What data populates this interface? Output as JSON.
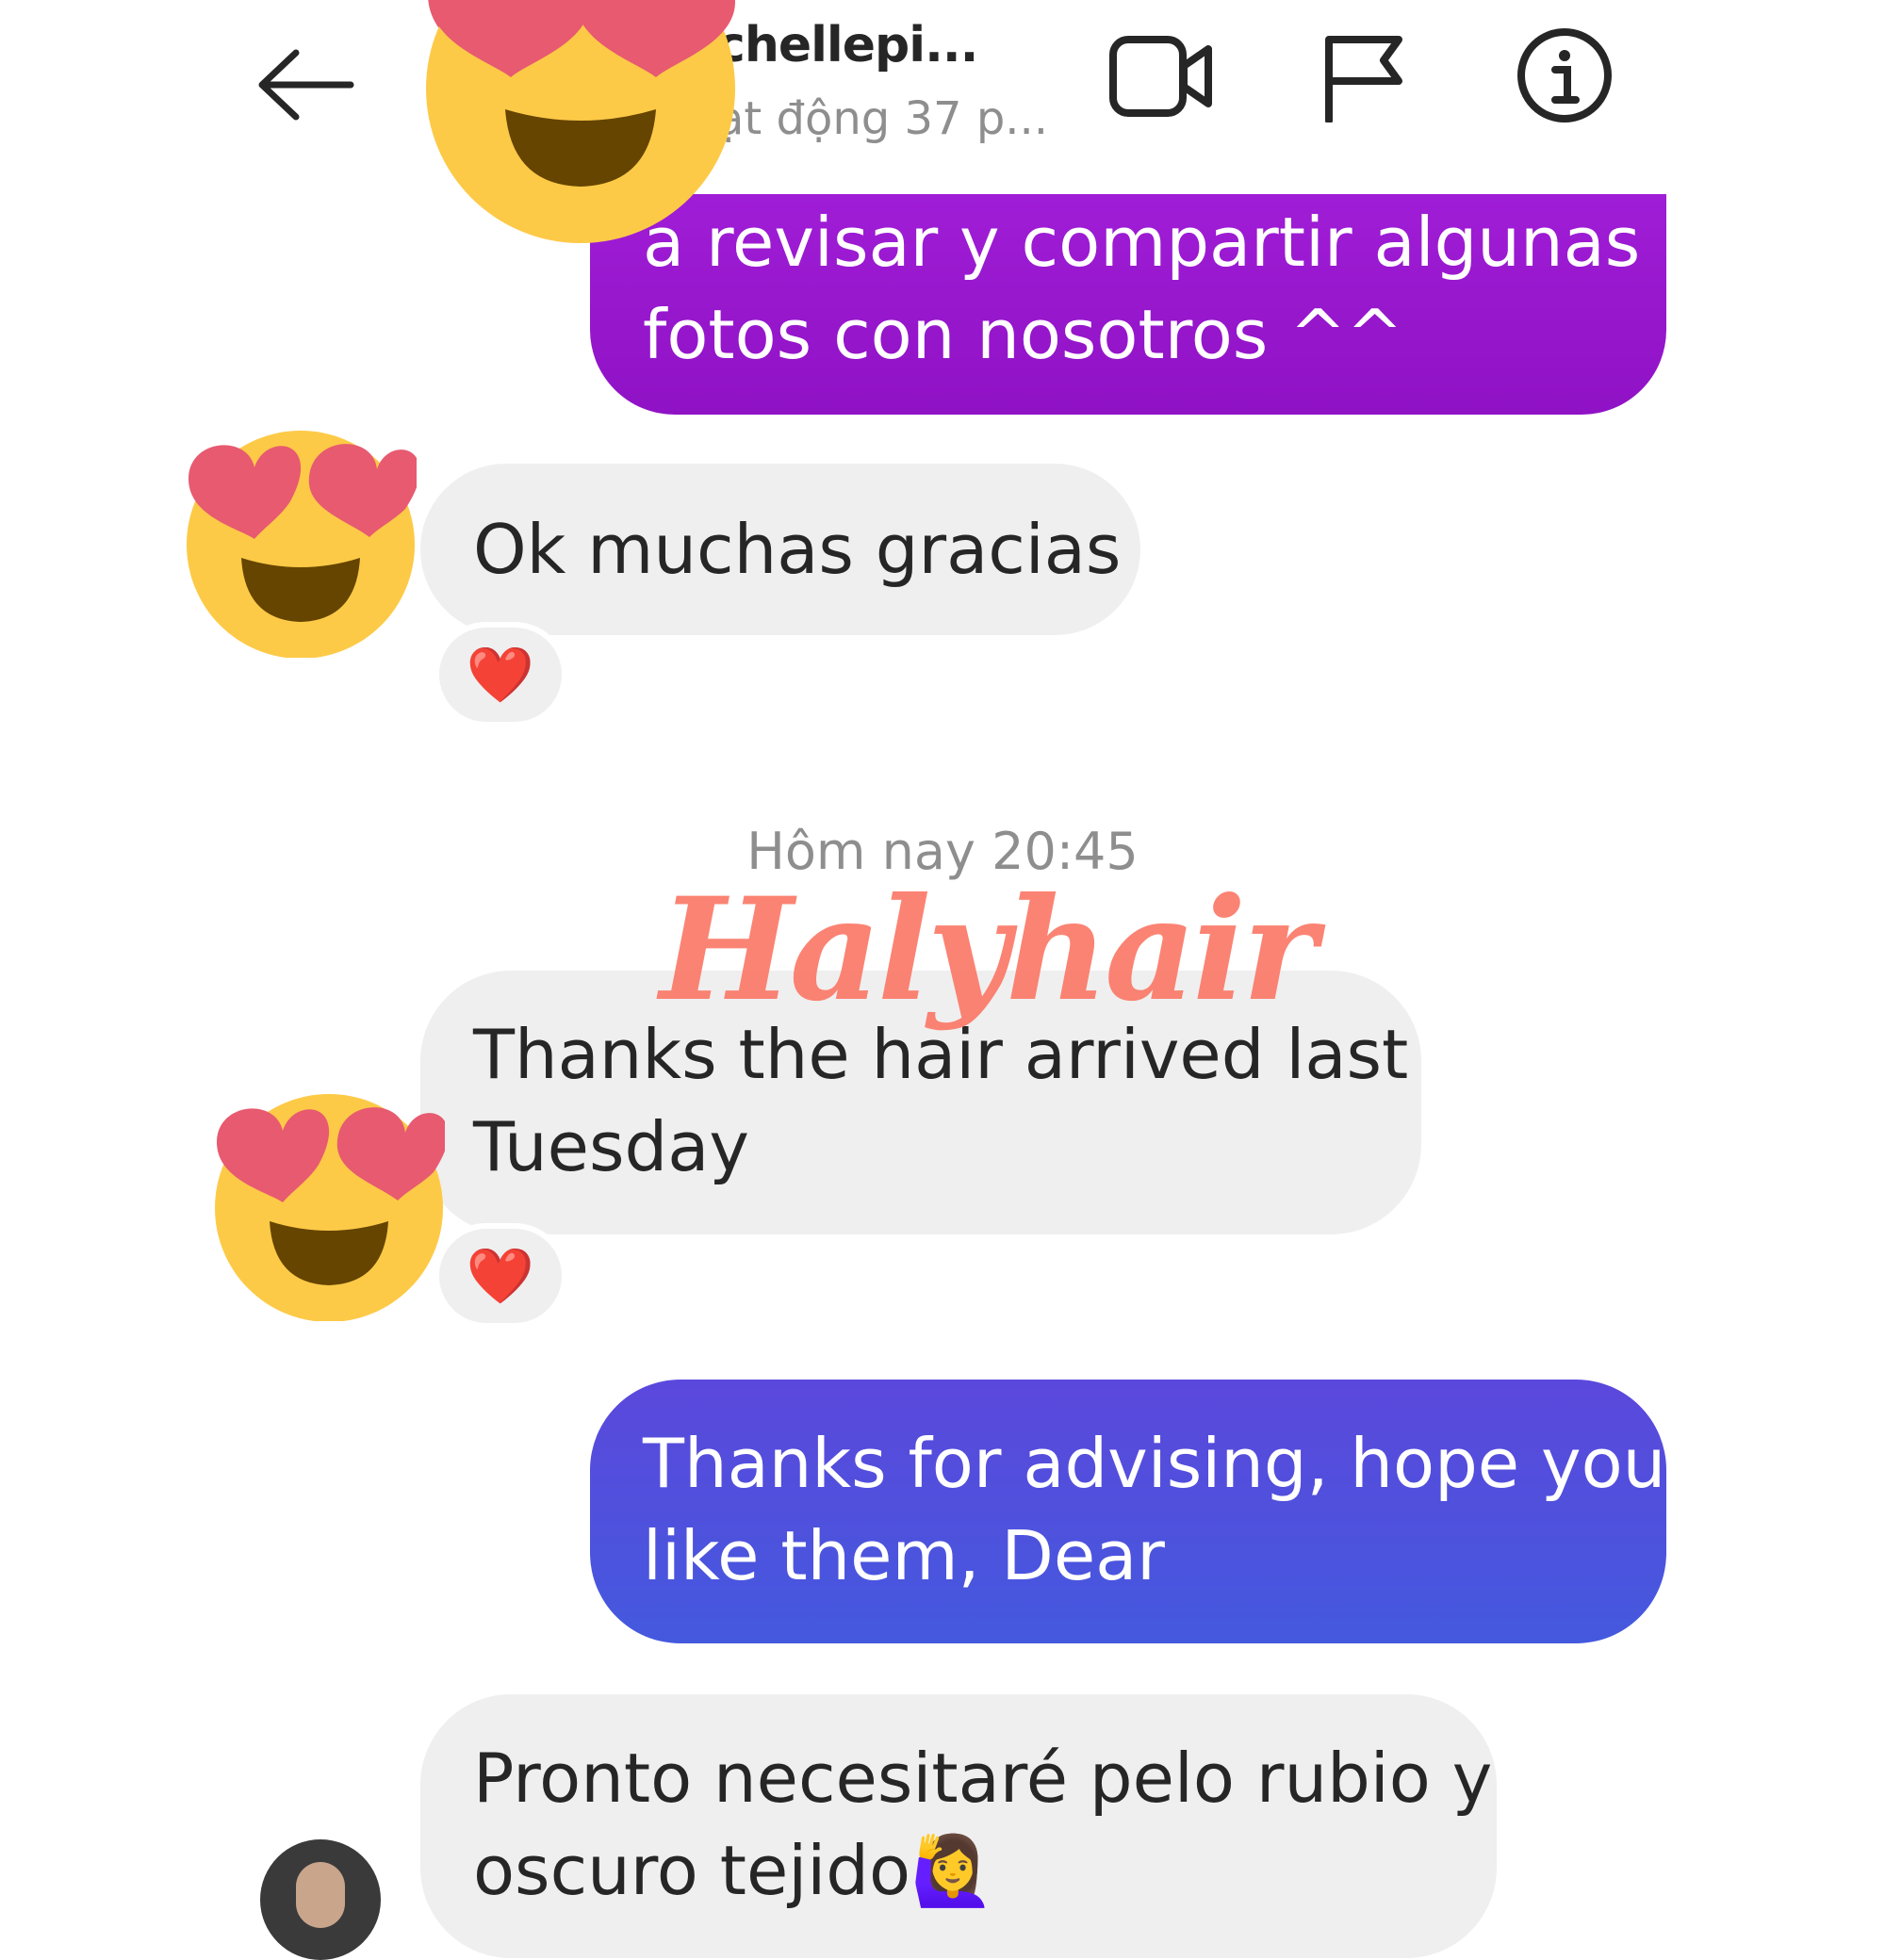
{
  "header": {
    "contact_name": "chellepi...",
    "status": "ạt động 37 p..."
  },
  "messages": {
    "out_1": {
      "lines": [
        "a revisar y compartir algunas",
        "fotos con nosotros ^^"
      ]
    },
    "in_1": {
      "text": "Ok muchas gracias",
      "reaction": "❤️"
    },
    "timestamp": "Hôm nay 20:45",
    "in_2": {
      "lines": [
        "Thanks the hair arrived last",
        "Tuesday"
      ],
      "reaction": "❤️"
    },
    "out_2": {
      "lines": [
        "Thanks for advising, hope you",
        "like them, Dear"
      ]
    },
    "in_3": {
      "lines": [
        "Pronto necesitaré pelo rubio y",
        "oscuro tejido"
      ],
      "emoji": "🙋‍♀️"
    }
  },
  "watermark": "Halyhair",
  "icons": {
    "back": "arrow-left-icon",
    "video": "video-camera-icon",
    "flag": "flag-icon",
    "info": "info-icon",
    "sticker": "heart-eyes-emoji"
  },
  "colors": {
    "outgoing_purple_top": "#9f1dd6",
    "outgoing_purple_bottom": "#9012c5",
    "outgoing_blue_top": "#5b48dc",
    "outgoing_blue_bottom": "#4459de",
    "incoming_bg": "#efefef",
    "watermark": "#fb7d6c",
    "timestamp": "#8e8e8e"
  }
}
